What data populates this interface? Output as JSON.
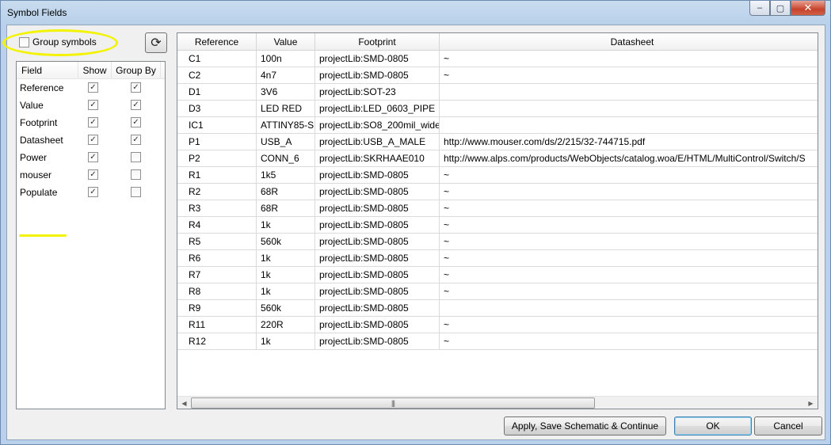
{
  "window": {
    "title": "Symbol Fields",
    "minimize_glyph": "–",
    "maximize_glyph": "▢",
    "close_glyph": "✕"
  },
  "options": {
    "group_symbols_label": "Group symbols",
    "group_symbols_checked": false,
    "refresh_icon": "⟳"
  },
  "fields": {
    "headers": {
      "field": "Field",
      "show": "Show",
      "group_by": "Group By"
    },
    "rows": [
      {
        "name": "Reference",
        "show": true,
        "group_by": true
      },
      {
        "name": "Value",
        "show": true,
        "group_by": true
      },
      {
        "name": "Footprint",
        "show": true,
        "group_by": true
      },
      {
        "name": "Datasheet",
        "show": true,
        "group_by": true
      },
      {
        "name": "Power",
        "show": true,
        "group_by": false
      },
      {
        "name": "mouser",
        "show": true,
        "group_by": false
      },
      {
        "name": "Populate",
        "show": true,
        "group_by": false
      }
    ]
  },
  "grid": {
    "columns": [
      "Reference",
      "Value",
      "Footprint",
      "Datasheet"
    ],
    "rows": [
      [
        "C1",
        "100n",
        "projectLib:SMD-0805",
        "~"
      ],
      [
        "C2",
        "4n7",
        "projectLib:SMD-0805",
        "~"
      ],
      [
        "D1",
        "3V6",
        "projectLib:SOT-23",
        ""
      ],
      [
        "D3",
        "LED RED",
        "projectLib:LED_0603_PIPE",
        ""
      ],
      [
        "IC1",
        "ATTINY85-S",
        "projectLib:SO8_200mil_wide",
        ""
      ],
      [
        "P1",
        "USB_A",
        "projectLib:USB_A_MALE",
        "http://www.mouser.com/ds/2/215/32-744715.pdf"
      ],
      [
        "P2",
        "CONN_6",
        "projectLib:SKRHAAE010",
        "http://www.alps.com/products/WebObjects/catalog.woa/E/HTML/MultiControl/Switch/S"
      ],
      [
        "R1",
        "1k5",
        "projectLib:SMD-0805",
        "~"
      ],
      [
        "R2",
        "68R",
        "projectLib:SMD-0805",
        "~"
      ],
      [
        "R3",
        "68R",
        "projectLib:SMD-0805",
        "~"
      ],
      [
        "R4",
        "1k",
        "projectLib:SMD-0805",
        "~"
      ],
      [
        "R5",
        "560k",
        "projectLib:SMD-0805",
        "~"
      ],
      [
        "R6",
        "1k",
        "projectLib:SMD-0805",
        "~"
      ],
      [
        "R7",
        "1k",
        "projectLib:SMD-0805",
        "~"
      ],
      [
        "R8",
        "1k",
        "projectLib:SMD-0805",
        "~"
      ],
      [
        "R9",
        "560k",
        "projectLib:SMD-0805",
        ""
      ],
      [
        "R11",
        "220R",
        "projectLib:SMD-0805",
        "~"
      ],
      [
        "R12",
        "1k",
        "projectLib:SMD-0805",
        "~"
      ]
    ],
    "scroll_left_glyph": "◀",
    "scroll_right_glyph": "▶",
    "scroll_thumb_grip": "|||"
  },
  "buttons": {
    "apply": "Apply, Save Schematic & Continue",
    "ok": "OK",
    "cancel": "Cancel"
  },
  "colors": {
    "highlight": "#f3f300",
    "window_frame": "#b9d1ea",
    "dialog_bg": "#f0f0f0"
  }
}
